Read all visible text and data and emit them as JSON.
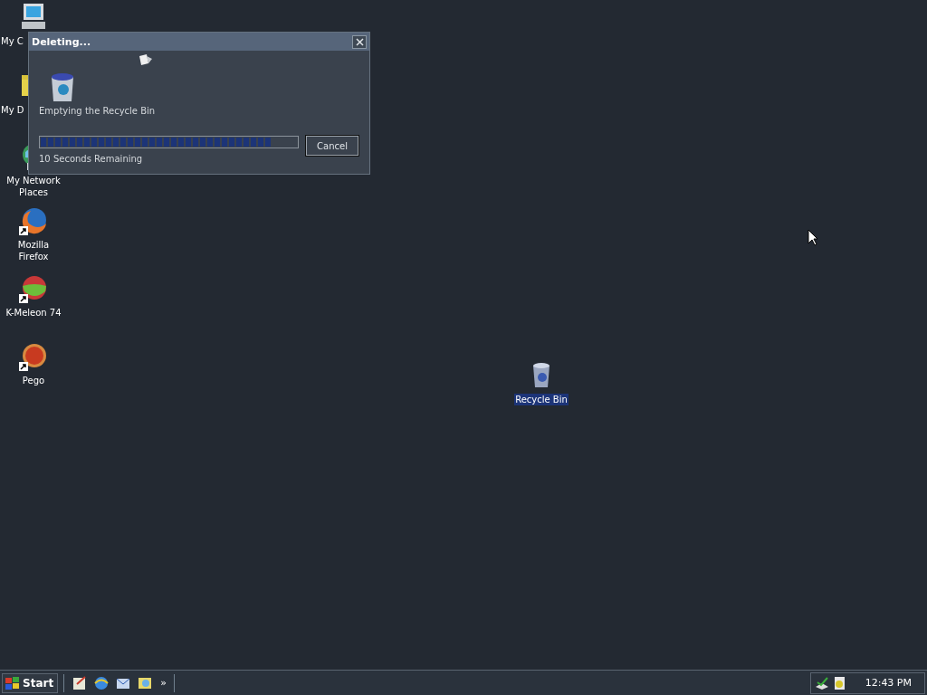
{
  "desktop_icons": [
    {
      "label": "My C",
      "kind": "computer",
      "selected": false
    },
    {
      "label": "My D",
      "kind": "documents",
      "selected": false
    },
    {
      "label": "My Network Places",
      "kind": "network",
      "selected": false
    },
    {
      "label": "Mozilla Firefox",
      "kind": "firefox",
      "selected": false
    },
    {
      "label": "K-Meleon 74",
      "kind": "kmeleon",
      "selected": false
    },
    {
      "label": "Pego",
      "kind": "pego",
      "selected": false
    },
    {
      "label": "Recycle Bin",
      "kind": "recycle",
      "selected": true
    }
  ],
  "dialog": {
    "title": "Deleting...",
    "message": "Emptying the Recycle Bin",
    "progress": {
      "level": 0.9
    },
    "status": "10 Seconds Remaining",
    "button": "Cancel"
  },
  "taskbar": {
    "start": "Start",
    "more": "»",
    "clock": "12:43 PM"
  }
}
